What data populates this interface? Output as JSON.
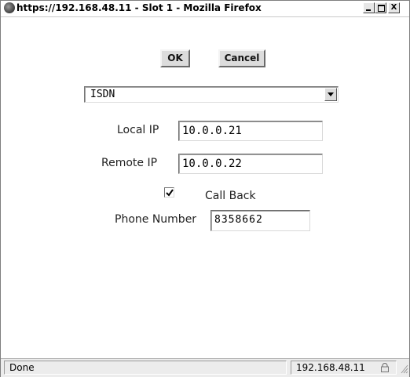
{
  "window": {
    "title": "https://192.168.48.11 - Slot 1 - Mozilla Firefox",
    "minimize_label": "_",
    "close_label": "X"
  },
  "dialog": {
    "ok_label": "OK",
    "cancel_label": "Cancel",
    "connection_type": {
      "selected": "ISDN"
    },
    "local_ip": {
      "label": "Local IP",
      "value": "10.0.0.21"
    },
    "remote_ip": {
      "label": "Remote IP",
      "value": "10.0.0.22"
    },
    "call_back": {
      "label": "Call Back",
      "checked": true
    },
    "phone_number": {
      "label": "Phone Number",
      "value": "8358662"
    }
  },
  "statusbar": {
    "status": "Done",
    "host": "192.168.48.11"
  },
  "icons": {
    "app": "firefox-icon",
    "lock": "lock-icon",
    "grip": "resize-grip-icon",
    "dropdown": "dropdown-arrow-icon",
    "check": "checkmark-icon"
  }
}
